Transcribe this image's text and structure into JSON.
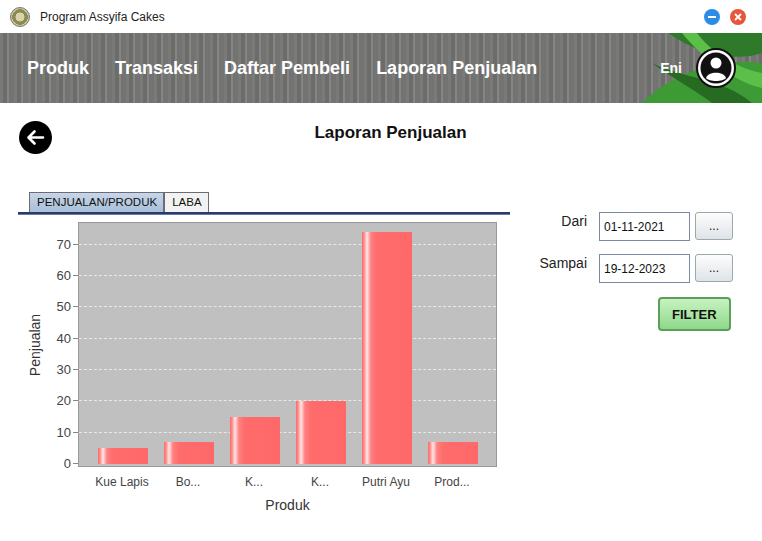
{
  "window": {
    "title": "Program Assyifa Cakes"
  },
  "nav": {
    "items": [
      "Produk",
      "Transaksi",
      "Daftar Pembeli",
      "Laporan Penjualan"
    ]
  },
  "user": {
    "name": "Eni"
  },
  "page": {
    "title": "Laporan Penjualan"
  },
  "tabs": [
    {
      "label": "PENJUALAN/PRODUK",
      "selected": true
    },
    {
      "label": "LABA",
      "selected": false
    }
  ],
  "chart": {
    "y_axis": {
      "label": "Penjualan",
      "ticks": [
        "0",
        "10",
        "20",
        "30",
        "40",
        "50",
        "60",
        "70"
      ]
    },
    "x_axis": {
      "label": "Produk",
      "categories": [
        "Kue Lapis",
        "Bo...",
        "K...",
        "K...",
        "Putri Ayu",
        "Prod..."
      ]
    },
    "series": [
      {
        "values": [
          5,
          7,
          15,
          20,
          74,
          7
        ]
      }
    ]
  },
  "filter": {
    "fields": [
      {
        "label": "Dari",
        "value": "01-11-2021",
        "button": "..."
      },
      {
        "label": "Sampai",
        "value": "19-12-2023",
        "button": "..."
      }
    ],
    "submit": "FILTER"
  }
}
